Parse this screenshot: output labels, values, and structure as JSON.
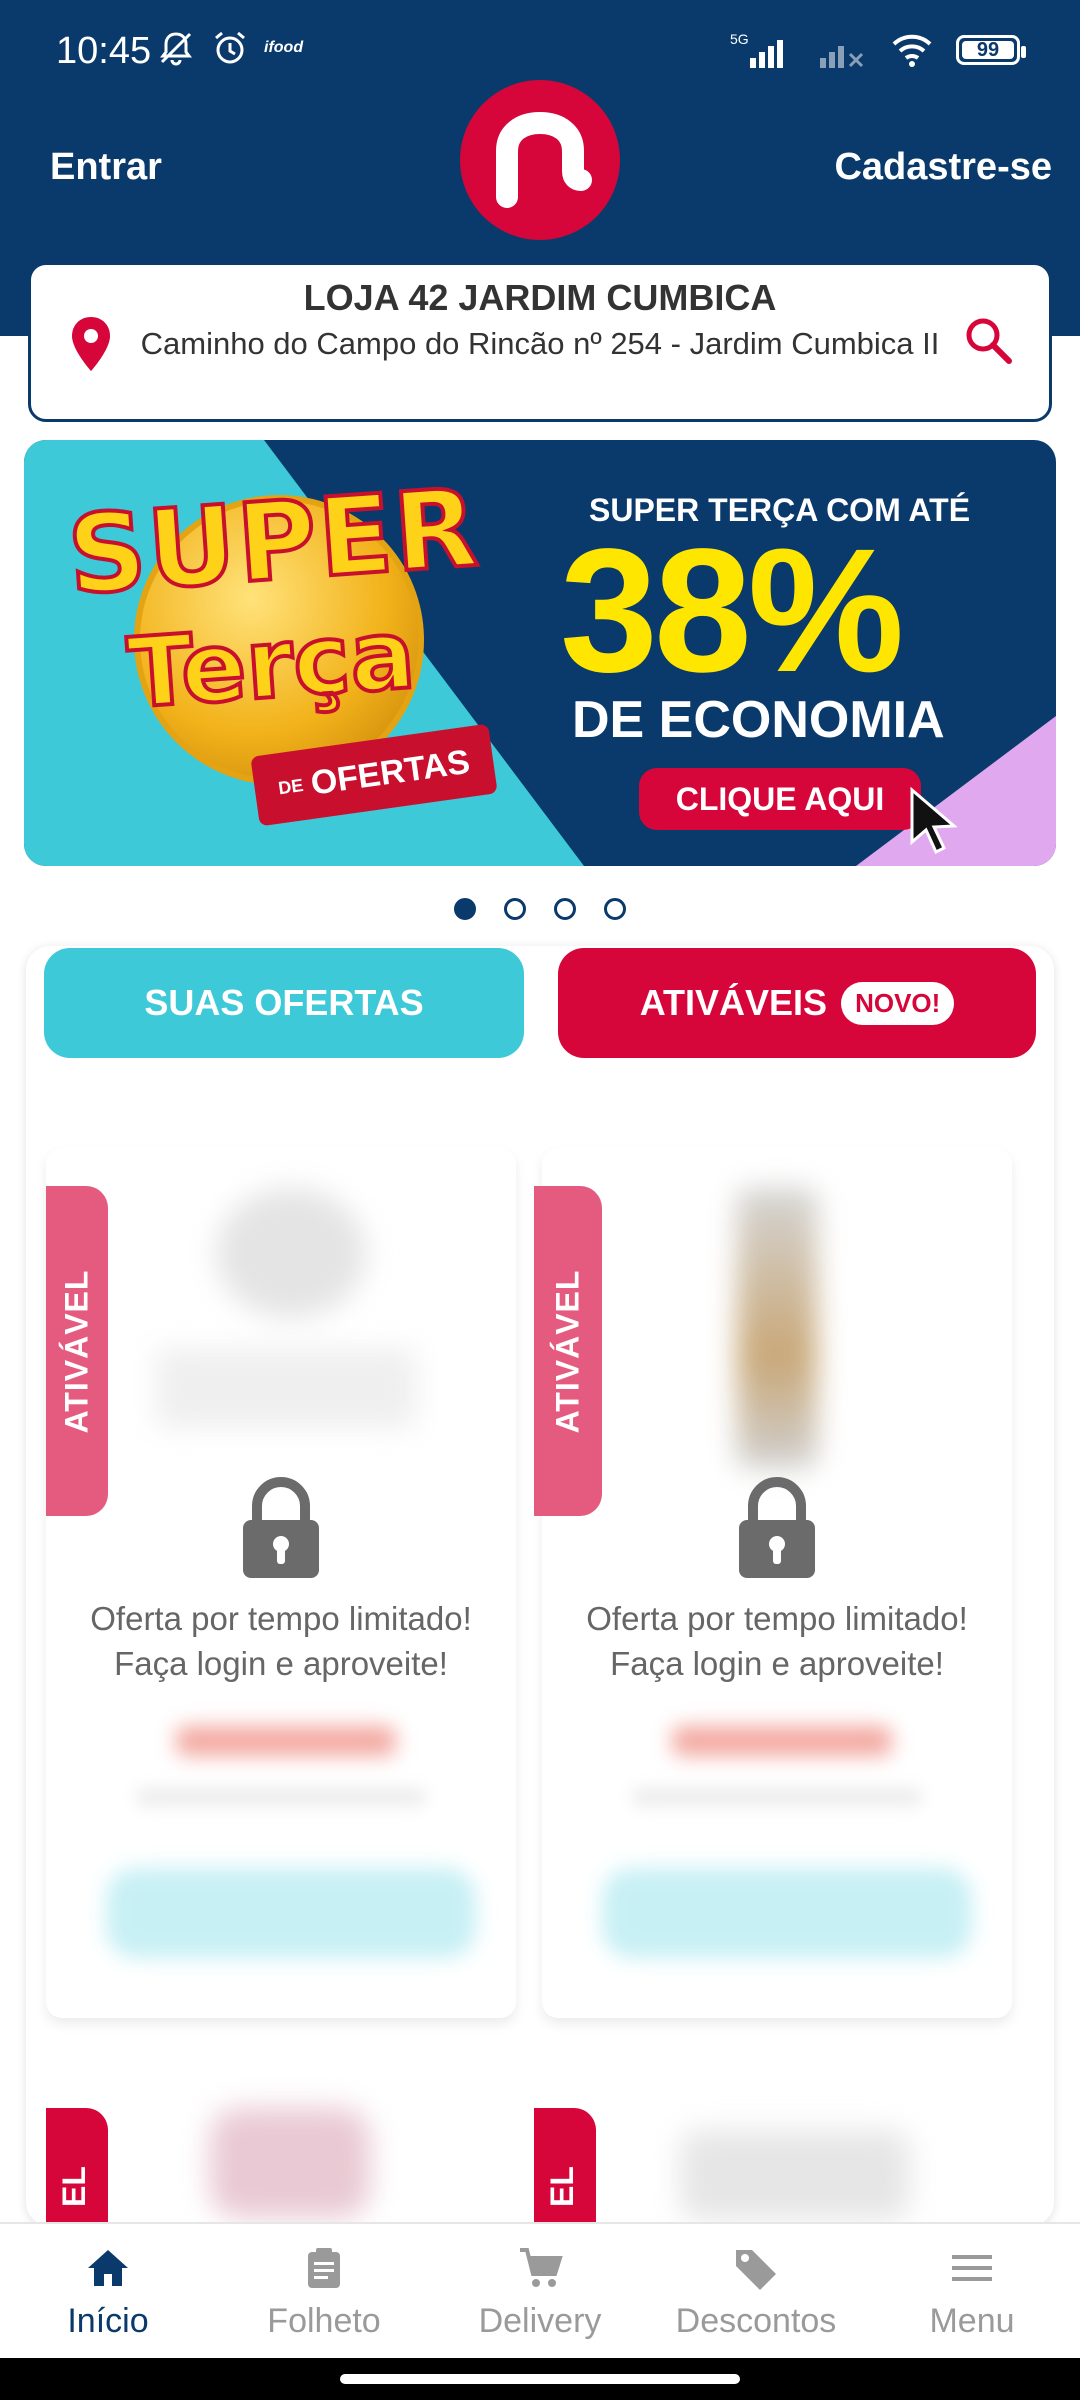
{
  "status_bar": {
    "time": "10:45",
    "ifood": "ifood",
    "network": "5G",
    "battery": "99"
  },
  "header": {
    "login_label": "Entrar",
    "signup_label": "Cadastre-se",
    "logo_icon": "brand-n-logo"
  },
  "store": {
    "name": "LOJA 42 JARDIM CUMBICA",
    "address": "Caminho do Campo do Rincão nº 254 -  Jardim Cumbica II"
  },
  "banner": {
    "super": "SUPER",
    "terca": "Terça",
    "de": "DE",
    "ofertas": "OFERTAS",
    "line1": "SUPER TERÇA COM ATÉ",
    "percent": "38%",
    "line3": "DE ECONOMIA",
    "cta": "CLIQUE AQUI",
    "active_slide": 1,
    "slide_count": 4
  },
  "tabs": {
    "offers": "SUAS OFERTAS",
    "activatable": "ATIVÁVEIS",
    "new_badge": "NOVO!"
  },
  "products": [
    {
      "tag": "ATIVÁVEL",
      "line1": "Oferta por tempo limitado!",
      "line2": "Faça login e aproveite!"
    },
    {
      "tag": "ATIVÁVEL",
      "line1": "Oferta por tempo limitado!",
      "line2": "Faça login e aproveite!"
    }
  ],
  "peek_tags": [
    "EL",
    "EL"
  ],
  "bottom_nav": [
    {
      "label": "Início",
      "icon": "home-icon",
      "active": true
    },
    {
      "label": "Folheto",
      "icon": "clipboard-icon"
    },
    {
      "label": "Delivery",
      "icon": "cart-icon"
    },
    {
      "label": "Descontos",
      "icon": "tag-icon"
    },
    {
      "label": "Menu",
      "icon": "menu-icon"
    }
  ],
  "colors": {
    "primary": "#0a3a6b",
    "accent_red": "#d7063a",
    "accent_cyan": "#3ec9d8",
    "tag_pink": "#e55b80"
  }
}
